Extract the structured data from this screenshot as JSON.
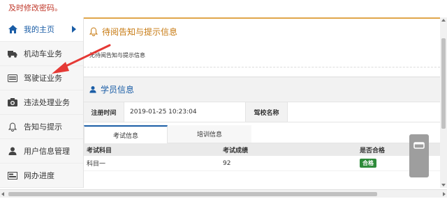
{
  "notice_text": "及时修改密码。",
  "sidebar": {
    "items": [
      {
        "label": "我的主页",
        "icon": "home-icon",
        "active": true
      },
      {
        "label": "机动车业务",
        "icon": "truck-icon"
      },
      {
        "label": "驾驶证业务",
        "icon": "id-card-icon"
      },
      {
        "label": "违法处理业务",
        "icon": "camera-icon"
      },
      {
        "label": "告知与提示",
        "icon": "bell-icon"
      },
      {
        "label": "用户信息管理",
        "icon": "user-icon"
      },
      {
        "label": "网办进度",
        "icon": "progress-icon"
      }
    ]
  },
  "notice_panel": {
    "title": "待阅告知与提示信息",
    "body": "无待阅告知与提示信息"
  },
  "student_panel": {
    "title": "学员信息",
    "reg_time_label": "注册时间",
    "reg_time_value": "2019-01-25 10:23:04",
    "school_label": "驾校名称",
    "school_value": ""
  },
  "tabs": [
    {
      "label": "考试信息",
      "active": true
    },
    {
      "label": "培训信息",
      "active": false
    }
  ],
  "exam_table": {
    "headers": [
      "考试科目",
      "考试成绩",
      "是否合格"
    ],
    "rows": [
      {
        "subject": "科目一",
        "score": "92",
        "pass": "合格"
      }
    ]
  },
  "colors": {
    "accent": "#1a5da6",
    "warn": "#e0a64a",
    "pass": "#2e8b3a",
    "annotation_arrow": "#e53935"
  }
}
